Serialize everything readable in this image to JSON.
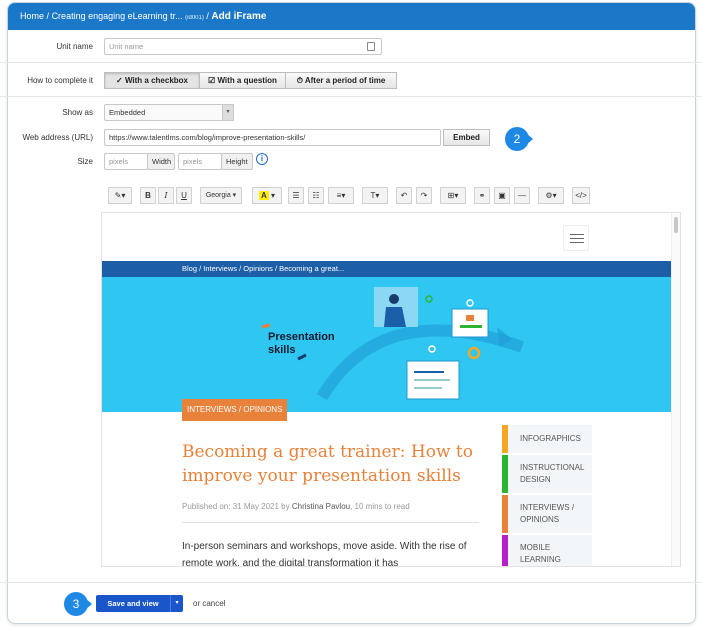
{
  "breadcrumb": {
    "home": "Home",
    "sep": "/",
    "course": "Creating engaging eLearning tr...",
    "course_code": "(id001)",
    "current": "Add iFrame"
  },
  "form": {
    "unit_name_label": "Unit name",
    "unit_name_placeholder": "Unit name",
    "complete_label": "How to complete it",
    "complete_options": [
      "With a checkbox",
      "With a question",
      "After a period of time"
    ],
    "show_as_label": "Show as",
    "show_as_value": "Embedded",
    "url_label": "Web address (URL)",
    "url_value": "https://www.talentlms.com/blog/improve-presentation-skills/",
    "embed_label": "Embed",
    "size_label": "Size",
    "width_placeholder": "pixels",
    "width_label": "Width",
    "height_placeholder": "pixels",
    "height_label": "Height"
  },
  "toolbar": {
    "font": "Georgia",
    "bold": "B",
    "italic": "I",
    "underline": "U"
  },
  "preview": {
    "crumb": "Blog  /  Interviews / Opinions  /  Becoming a great...",
    "hero_text_1": "Presentation",
    "hero_text_2": "skills",
    "tag": "INTERVIEWS / OPINIONS",
    "title": "Becoming a great trainer: How to improve your presentation skills",
    "published": "Published on: 31 May 2021 by ",
    "author": "Christina Pavlou",
    "read_time": ", 10 mins to read",
    "body": "In-person seminars and workshops, move aside. With the rise of remote work, and the digital transformation it has",
    "categories": [
      {
        "label": "INFOGRAPHICS",
        "color": "#f5a623"
      },
      {
        "label": "INSTRUCTIONAL DESIGN",
        "color": "#2bb532"
      },
      {
        "label": "INTERVIEWS / OPINIONS",
        "color": "#e8813a"
      },
      {
        "label": "MOBILE LEARNING",
        "color": "#b620c9"
      }
    ]
  },
  "footer": {
    "save_label": "Save and view",
    "or_cancel": "or cancel"
  },
  "callouts": {
    "embed": "2",
    "save": "3"
  },
  "colors": {
    "topbar": "#1b78c8",
    "accent": "#1e88e5",
    "save": "#1a56c9",
    "hero": "#2fc7f2",
    "orange": "#e8813a"
  }
}
